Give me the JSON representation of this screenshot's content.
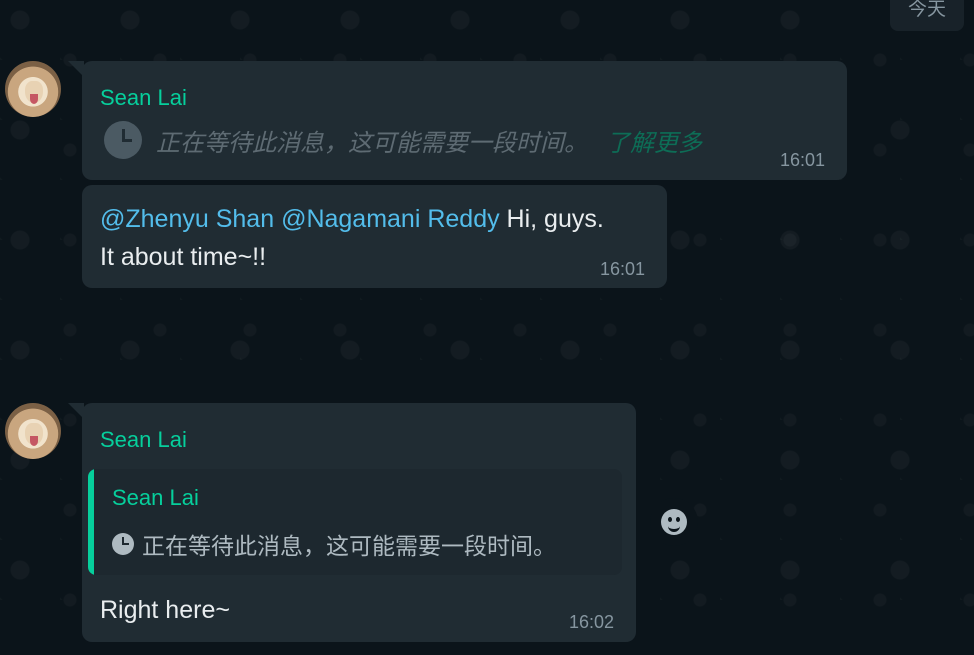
{
  "chat": {
    "date_chip": "今天",
    "messages": [
      {
        "sender": "Sean Lai",
        "waiting_text": "正在等待此消息，这可能需要一段时间。",
        "learn_more": "了解更多",
        "time": "16:01"
      },
      {
        "mention1": "@Zhenyu Shan",
        "mention2": "@Nagamani Reddy",
        "text_line1": " Hi, guys.",
        "text_line2": "It about time~!!",
        "time": "16:01"
      },
      {
        "sender": "Sean Lai",
        "quote_sender": "Sean Lai",
        "quote_text": "正在等待此消息，这可能需要一段时间。",
        "text": "Right here~",
        "time": "16:02"
      }
    ]
  },
  "colors": {
    "background": "#0b141a",
    "bubble": "#202c33",
    "sender": "#06cf9c",
    "mention": "#53bdeb"
  },
  "icons": {
    "clock": "clock-icon",
    "reaction": "emoji-icon"
  }
}
